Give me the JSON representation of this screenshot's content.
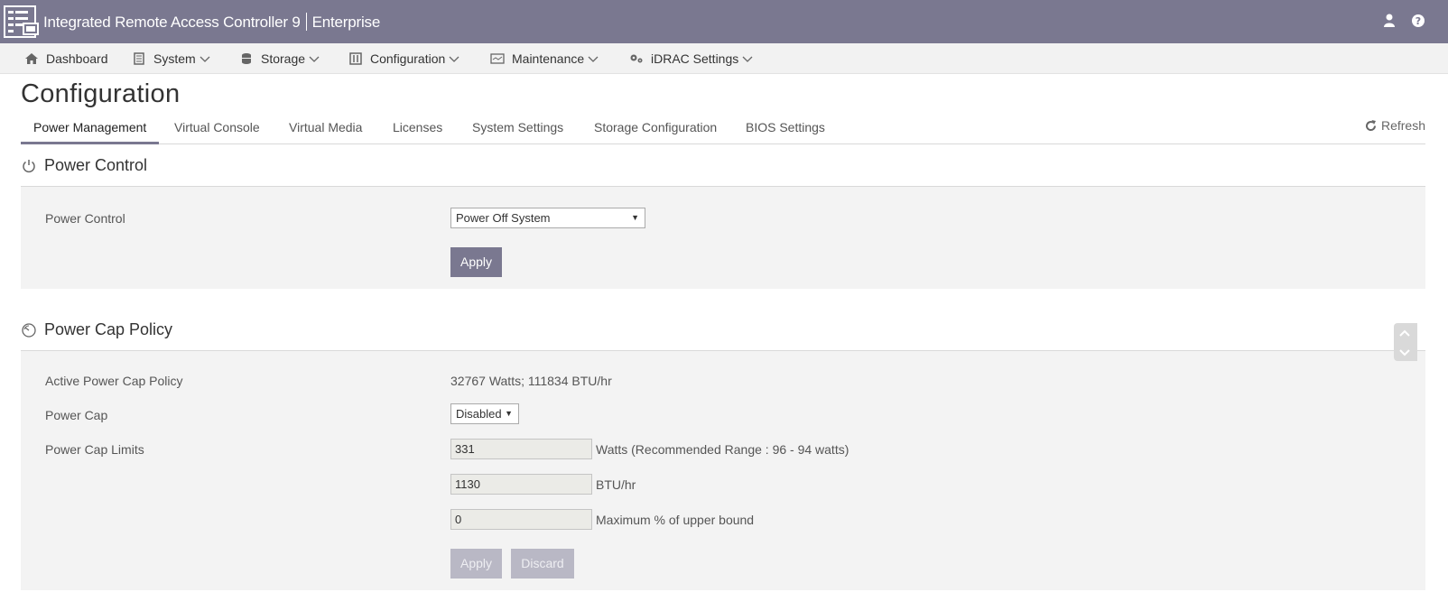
{
  "header": {
    "title": "Integrated Remote Access Controller 9",
    "edition": "Enterprise",
    "icons": [
      "server-logo-icon",
      "user-icon",
      "help-icon"
    ]
  },
  "nav": {
    "items": [
      {
        "label": "Dashboard",
        "icon": "home-icon"
      },
      {
        "label": "System",
        "icon": "system-icon"
      },
      {
        "label": "Storage",
        "icon": "storage-icon"
      },
      {
        "label": "Configuration",
        "icon": "configuration-icon"
      },
      {
        "label": "Maintenance",
        "icon": "maintenance-icon"
      },
      {
        "label": "iDRAC Settings",
        "icon": "settings-icon"
      }
    ]
  },
  "page": {
    "title": "Configuration",
    "refresh_label": "Refresh"
  },
  "tabs": [
    {
      "label": "Power Management",
      "active": true
    },
    {
      "label": "Virtual Console"
    },
    {
      "label": "Virtual Media"
    },
    {
      "label": "Licenses"
    },
    {
      "label": "System Settings"
    },
    {
      "label": "Storage Configuration"
    },
    {
      "label": "BIOS Settings"
    }
  ],
  "power_control": {
    "heading": "Power Control",
    "field_label": "Power Control",
    "selected": "Power Off System",
    "apply_label": "Apply"
  },
  "power_cap": {
    "heading": "Power Cap Policy",
    "active_label": "Active Power Cap Policy",
    "active_value": "32767 Watts; 111834 BTU/hr",
    "cap_label": "Power Cap",
    "cap_selected": "Disabled",
    "limits_label": "Power Cap Limits",
    "watts_value": "331",
    "watts_unit": "Watts (Recommended Range : 96 - 94 watts)",
    "btu_value": "1130",
    "btu_unit": "BTU/hr",
    "percent_value": "0",
    "percent_unit": "Maximum % of upper bound",
    "apply_label": "Apply",
    "discard_label": "Discard"
  },
  "colors": {
    "header_bg": "#7a7890",
    "panel_bg": "#f3f3f3",
    "button_bg": "#7a7890"
  }
}
